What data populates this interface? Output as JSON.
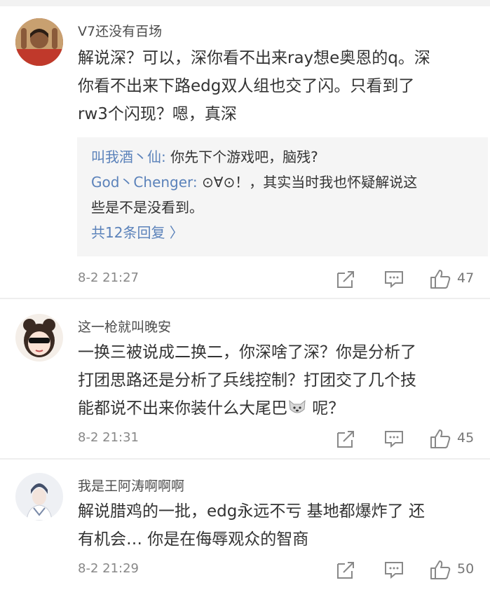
{
  "comments": [
    {
      "username": "V7还没有百场",
      "lines": [
        "解说深？可以，深你看不出来ray想e奥恩的q。深",
        "你看不出来下路edg双人组也交了闪。只看到了",
        "rw3个闪现？嗯，真深"
      ],
      "replies": [
        {
          "user": "叫我酒丶仙:",
          "lines": [
            " 你先下个游戏吧，脑残?"
          ]
        },
        {
          "user": "God丶Chenger:",
          "lines": [
            " ⊙∀⊙！，其实当时我也怀疑解说这",
            "些是不是没看到。"
          ]
        }
      ],
      "more_replies": "共12条回复 〉",
      "timestamp": "8-2 21:27",
      "likes": "47"
    },
    {
      "username": "这一枪就叫晚安",
      "lines": [
        "一换三被说成二换二，你深啥了深？你是分析了",
        "打团思路还是分析了兵线控制？打团交了几个技",
        "能都说不出来你装什么大尾巴",
        " 呢？"
      ],
      "timestamp": "8-2 21:31",
      "likes": "45"
    },
    {
      "username": "我是王阿涛啊啊啊",
      "lines": [
        "解说腊鸡的一批，edg永远不亏 基地都爆炸了 还",
        "有机会… 你是在侮辱观众的智商"
      ],
      "timestamp": "8-2 21:29",
      "likes": "50"
    }
  ],
  "icons": {
    "share": "share-icon",
    "reply": "comment-icon",
    "like": "thumbs-up-icon",
    "inline_emoji": "dog-emoji-icon"
  },
  "colors": {
    "link": "#5b82ba",
    "text": "#333333",
    "meta": "#888888",
    "reply_bg": "#f5f5f5"
  }
}
